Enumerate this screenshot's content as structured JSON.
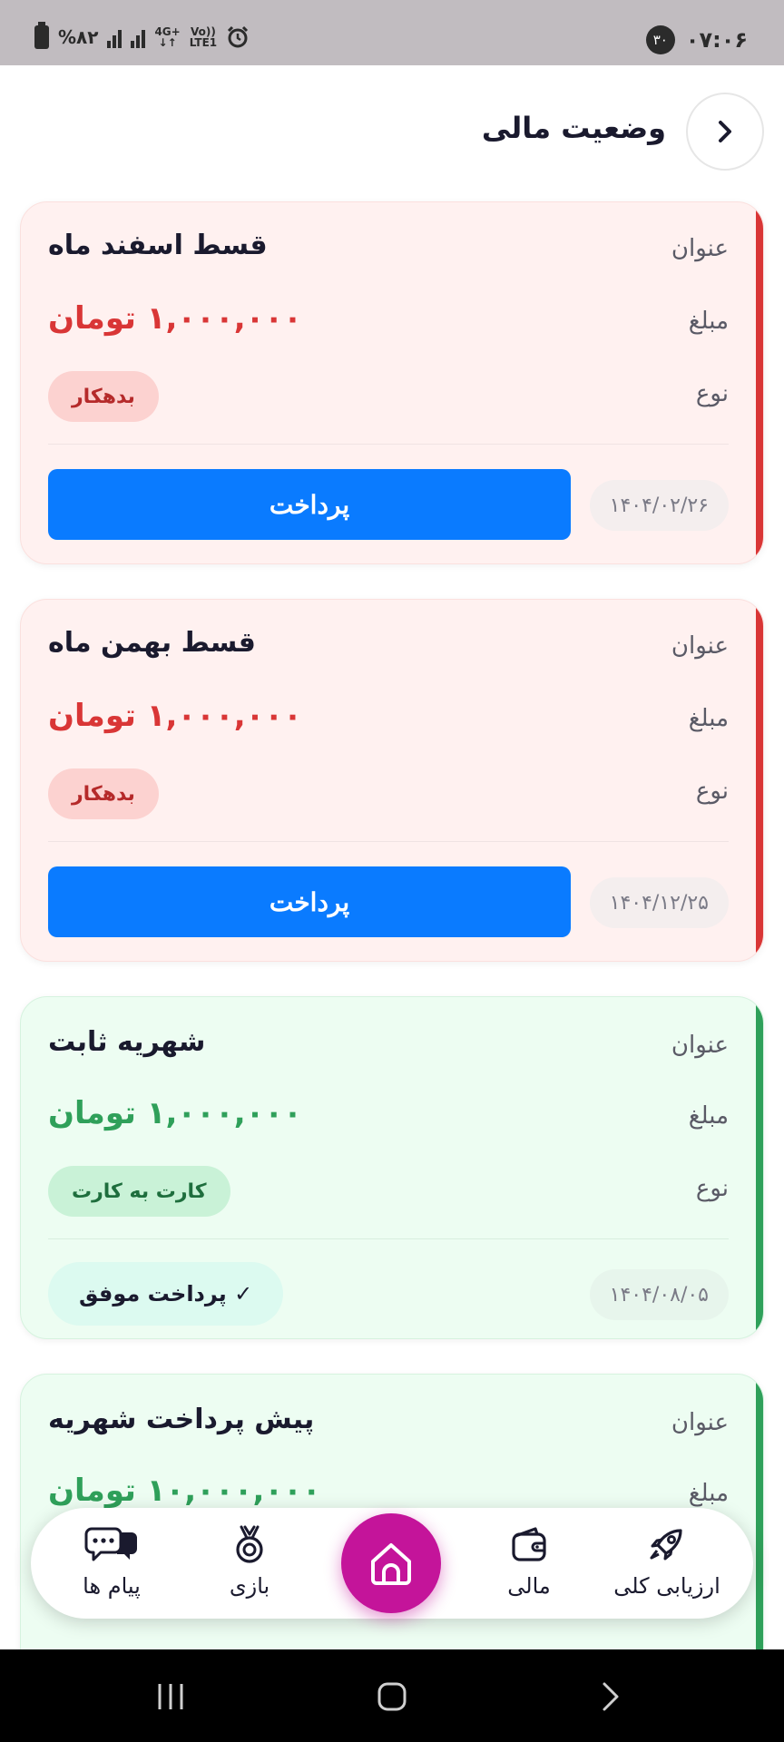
{
  "status_bar": {
    "time": "۰۷:۰۶",
    "notification_badge": "۳۰",
    "battery": "%۸۲",
    "network_top": "4G+",
    "network_bottom": "↓↑",
    "volte_top": "Vo))",
    "volte_bottom": "LTE1"
  },
  "header": {
    "title": "وضعیت مالی",
    "back_icon": "chevron-right-icon"
  },
  "labels": {
    "title": "عنوان",
    "amount": "مبلغ",
    "type": "نوع"
  },
  "cards": [
    {
      "status": "debtor",
      "accent_color": "#d93636",
      "title": "قسط اسفند ماه",
      "amount": "۱,۰۰۰,۰۰۰ تومان",
      "type": "بدهکار",
      "date": "۱۴۰۴/۰۲/۲۶",
      "action": "پرداخت"
    },
    {
      "status": "debtor",
      "accent_color": "#d93636",
      "title": "قسط بهمن ماه",
      "amount": "۱,۰۰۰,۰۰۰ تومان",
      "type": "بدهکار",
      "date": "۱۴۰۴/۱۲/۲۵",
      "action": "پرداخت"
    },
    {
      "status": "paid",
      "accent_color": "#2fa05a",
      "title": "شهریه ثابت",
      "amount": "۱,۰۰۰,۰۰۰ تومان",
      "type": "کارت به کارت",
      "date": "۱۴۰۴/۰۸/۰۵",
      "action": "✓ پرداخت موفق"
    },
    {
      "status": "paid",
      "accent_color": "#2fa05a",
      "title": "پیش پرداخت شهریه",
      "amount": "۱۰,۰۰۰,۰۰۰ تومان"
    }
  ],
  "bottom_nav": {
    "items": [
      {
        "label": "ارزیابی کلی",
        "icon": "rocket-icon"
      },
      {
        "label": "مالی",
        "icon": "wallet-icon"
      },
      {
        "label": "",
        "icon": "home-icon"
      },
      {
        "label": "بازی",
        "icon": "medal-icon"
      },
      {
        "label": "پیام ها",
        "icon": "chat-icon"
      }
    ],
    "active_color": "#c4149a"
  },
  "system_nav": {
    "icons": [
      "recents-icon",
      "home-circle-icon",
      "back-icon"
    ]
  }
}
